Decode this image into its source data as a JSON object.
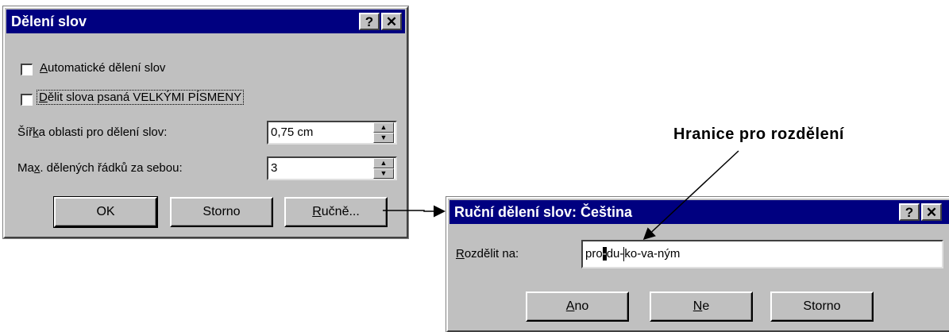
{
  "hyphenation_dialog": {
    "title": "Dělení slov",
    "help_button": "?",
    "close_button": "✕",
    "auto_hyphenate": {
      "prefix": "",
      "mnemonic": "A",
      "rest": "utomatické dělení slov",
      "checked": false
    },
    "hyphenate_caps": {
      "prefix": "",
      "mnemonic": "D",
      "rest": "ělit slova psaná VELKÝMI PÍSMENY",
      "checked": false
    },
    "zone_label": {
      "prefix": "Šíř",
      "mnemonic": "k",
      "rest": "a oblasti pro dělení slov:"
    },
    "zone_value": "0,75 cm",
    "max_label": {
      "prefix": "Ma",
      "mnemonic": "x",
      "rest": ". dělených řádků za sebou:"
    },
    "max_value": "3",
    "ok_button": "OK",
    "cancel_button": "Storno",
    "manual_button": {
      "prefix": "",
      "mnemonic": "R",
      "rest": "učně..."
    }
  },
  "manual_dialog": {
    "title": "Ruční dělení slov: Čeština",
    "help_button": "?",
    "close_button": "✕",
    "split_label": {
      "prefix": "",
      "mnemonic": "R",
      "rest": "ozdělit na:"
    },
    "word_before": "pro",
    "word_marked": "-",
    "word_after_a": "du-",
    "word_after_b": "ko-va-ným",
    "yes_button": {
      "prefix": "",
      "mnemonic": "A",
      "rest": "no"
    },
    "no_button": {
      "prefix": "",
      "mnemonic": "N",
      "rest": "e"
    },
    "cancel_button": "Storno"
  },
  "annotation": {
    "text": "Hranice pro rozdělení"
  }
}
